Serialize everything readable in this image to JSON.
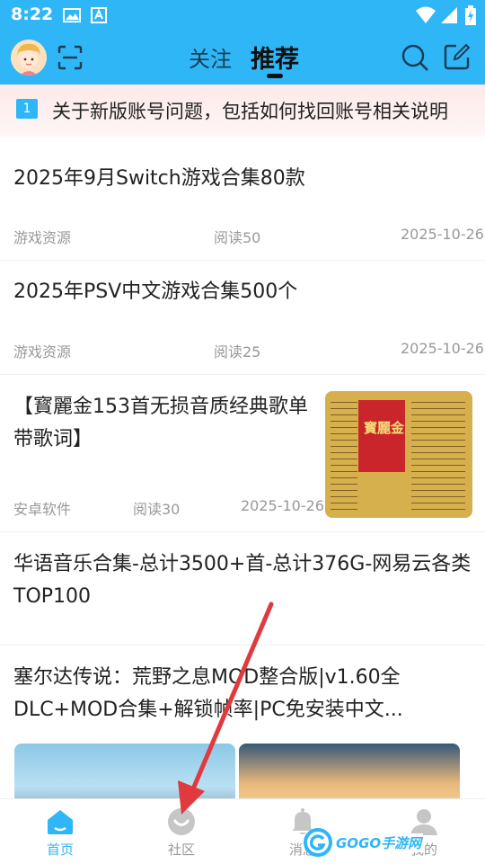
{
  "status_bar": {
    "time": "8:22",
    "icons": [
      "gallery-icon",
      "download-icon",
      "wifi-icon",
      "signal-icon",
      "battery-charging-icon"
    ]
  },
  "header": {
    "tabs": [
      {
        "label": "关注",
        "active": false
      },
      {
        "label": "推荐",
        "active": true
      }
    ],
    "accent_color": "#2fb6f6"
  },
  "notice": {
    "index": "1",
    "text": "关于新版账号问题，包括如何找回账号相关说明"
  },
  "feed": [
    {
      "title": "2025年9月Switch游戏合集80款",
      "category": "游戏资源",
      "reads": "阅读50",
      "date": "2025-10-26"
    },
    {
      "title": "2025年PSV中文游戏合集500个",
      "category": "游戏资源",
      "reads": "阅读25",
      "date": "2025-10-26"
    },
    {
      "title": "【寳麗金153首无损音质经典歌单带歌词】",
      "category": "安卓软件",
      "reads": "阅读30",
      "date": "2025-10-26",
      "thumb_text": "寳麗金"
    },
    {
      "title": "华语音乐合集-总计3500+首-总计376G-网易云各类TOP100"
    },
    {
      "title": "塞尔达传说：荒野之息MOD整合版|v1.60全DLC+MOD合集+解锁帧率|PC免安装中文..."
    }
  ],
  "bottom_nav": [
    {
      "label": "首页",
      "icon": "home-icon",
      "active": true
    },
    {
      "label": "社区",
      "icon": "community-icon",
      "active": false
    },
    {
      "label": "消息",
      "icon": "bell-icon",
      "active": false
    },
    {
      "label": "我的",
      "icon": "user-icon",
      "active": false
    }
  ],
  "watermark": "GOGO手游网"
}
